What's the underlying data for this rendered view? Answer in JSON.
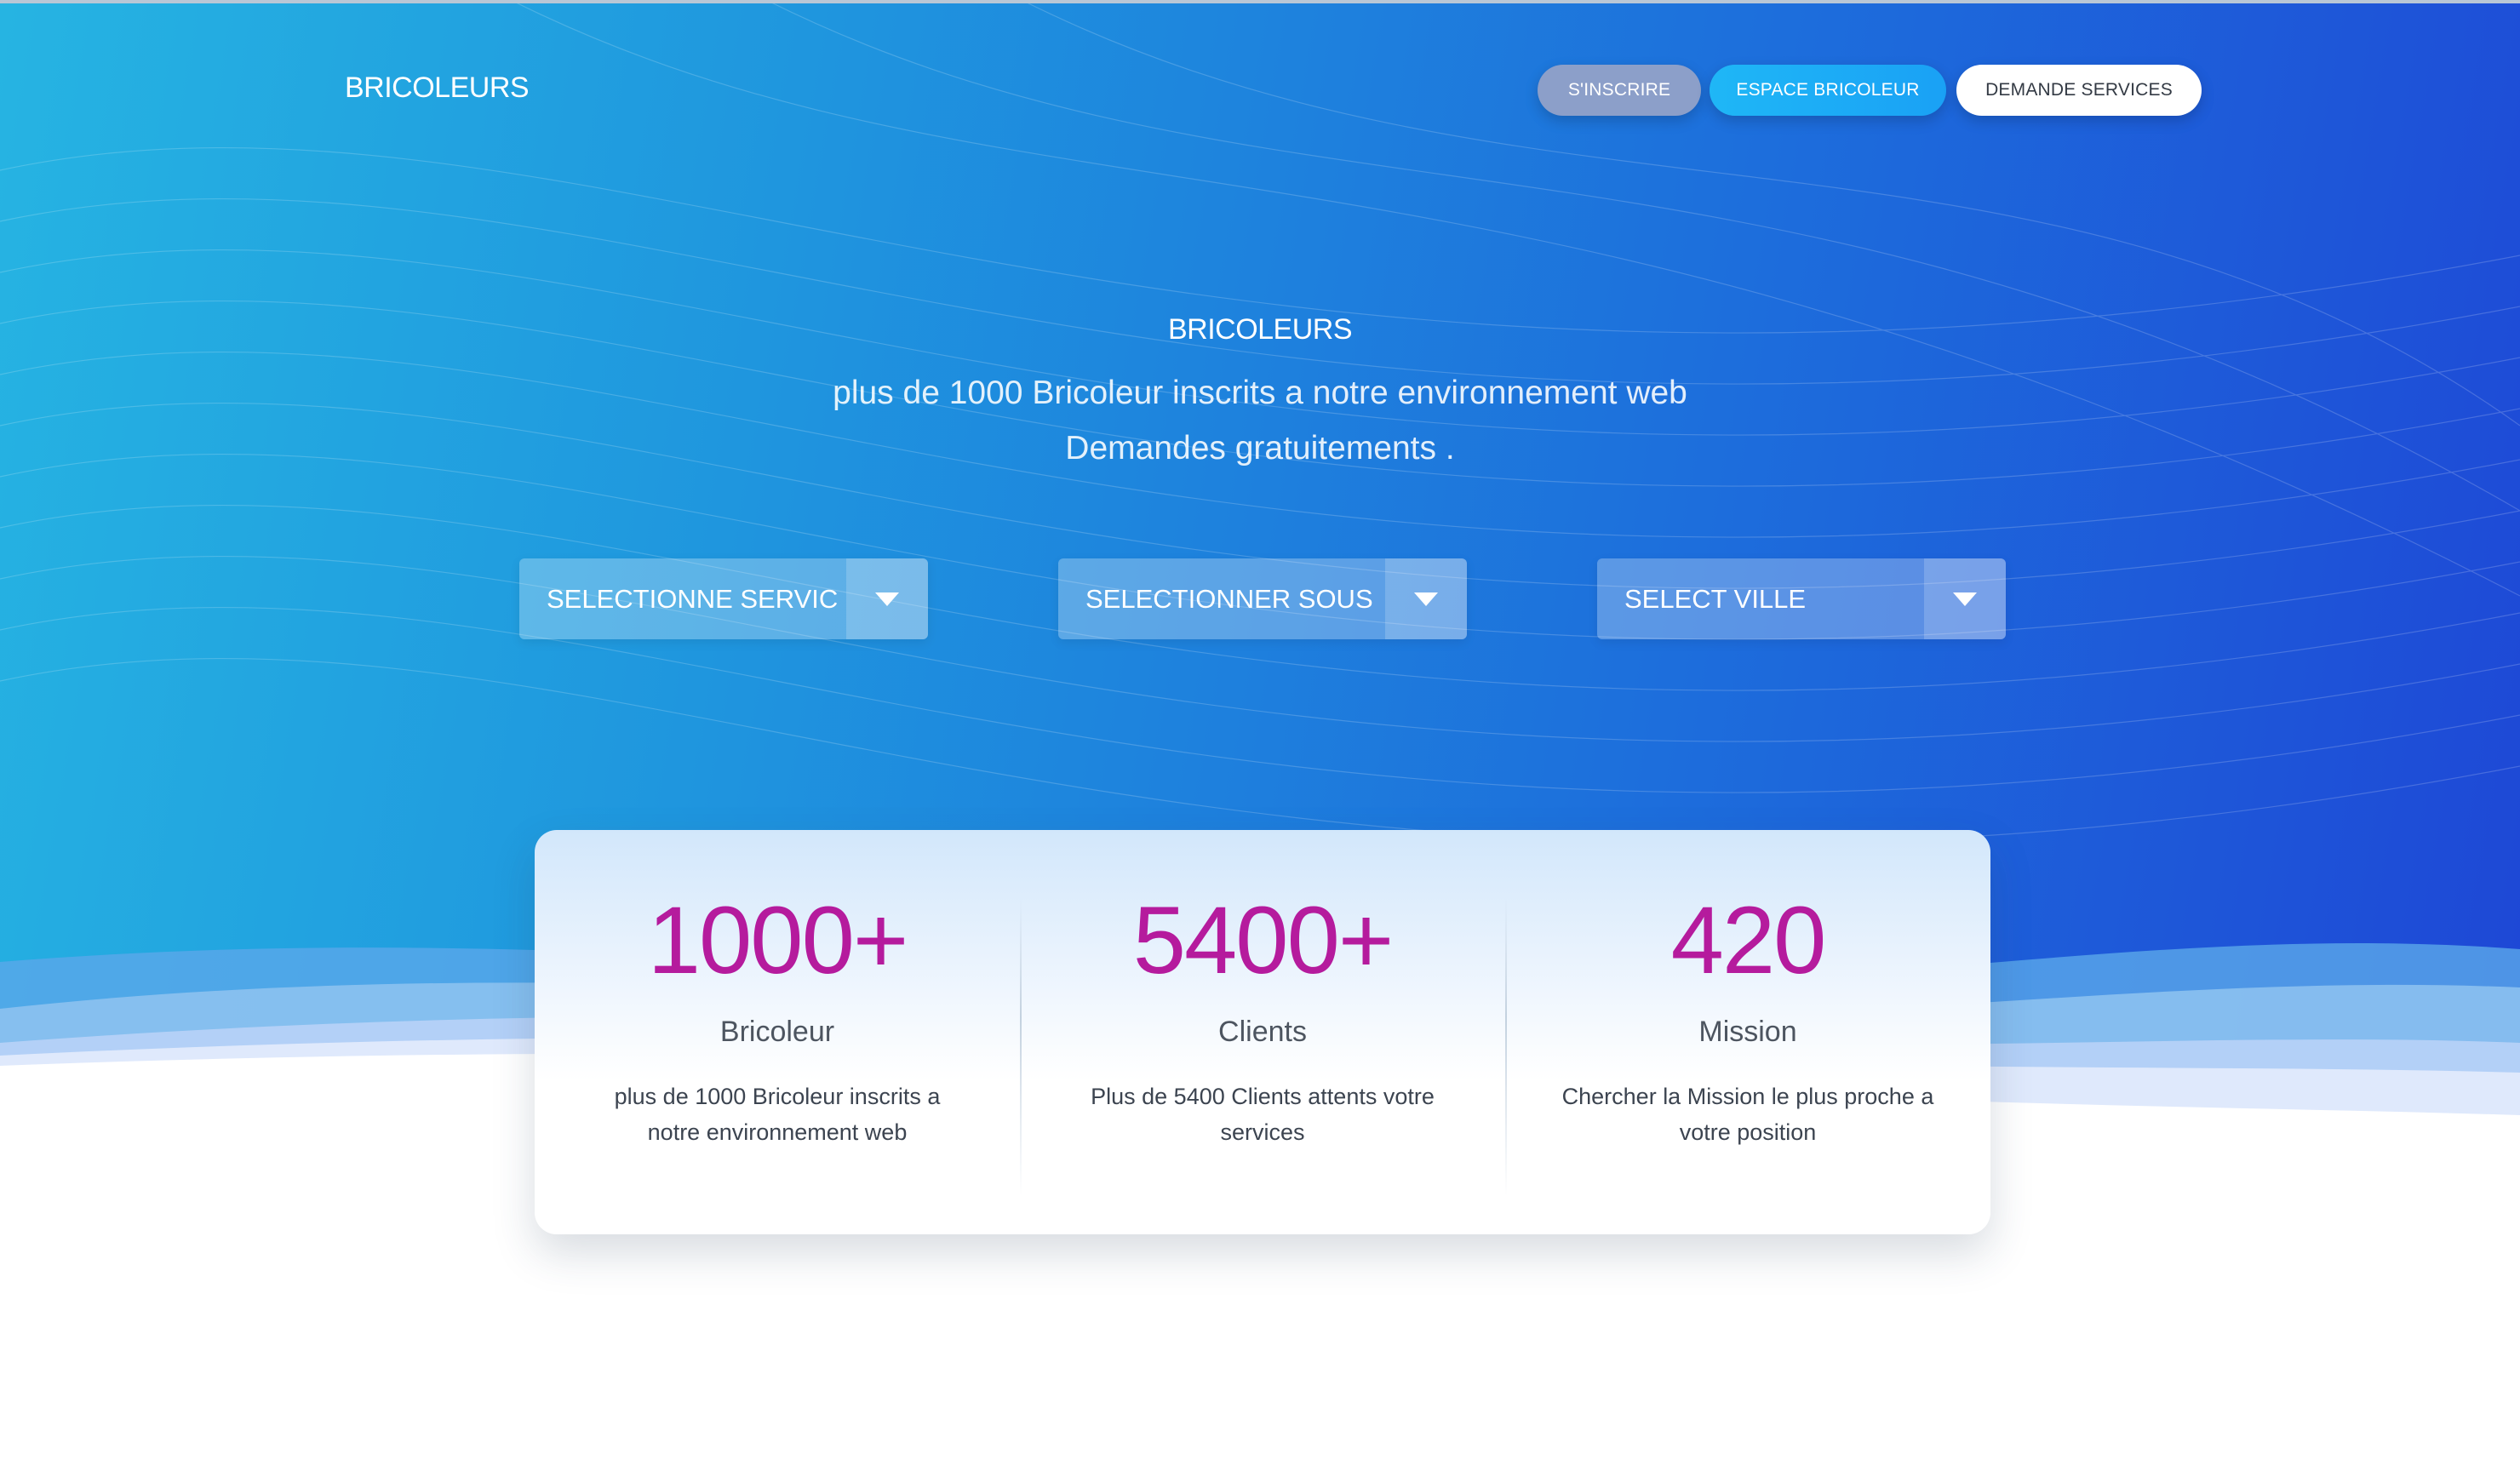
{
  "header": {
    "brand": "BRICOLEURS",
    "nav": {
      "signup": "S'INSCRIRE",
      "espace": "ESPACE BRICOLEUR",
      "demande": "DEMANDE SERVICES"
    }
  },
  "hero": {
    "title": "BRICOLEURS",
    "subtitle_line1": "plus de 1000 Bricoleur inscrits a notre environnement web",
    "subtitle_line2": "Demandes gratuitements ."
  },
  "filters": {
    "service": "SELECTIONNE SERVIC",
    "sous_service": "SELECTIONNER SOUS",
    "ville": "SELECT VILLE"
  },
  "stats": [
    {
      "value": "1000+",
      "label": "Bricoleur",
      "desc": "plus de 1000 Bricoleur inscrits a notre environnement web"
    },
    {
      "value": "5400+",
      "label": "Clients",
      "desc": "Plus de 5400 Clients attents votre services"
    },
    {
      "value": "420",
      "label": "Mission",
      "desc": "Chercher la Mission le plus proche a votre position"
    }
  ],
  "colors": {
    "accent_pink": "#b51b9d",
    "hero_start": "#26b4e2",
    "hero_end": "#1e47d6",
    "espace_button": "#1fb7f6",
    "signup_button": "#8c9fc9"
  },
  "icons": {
    "dropdown": "chevron-down-icon"
  }
}
